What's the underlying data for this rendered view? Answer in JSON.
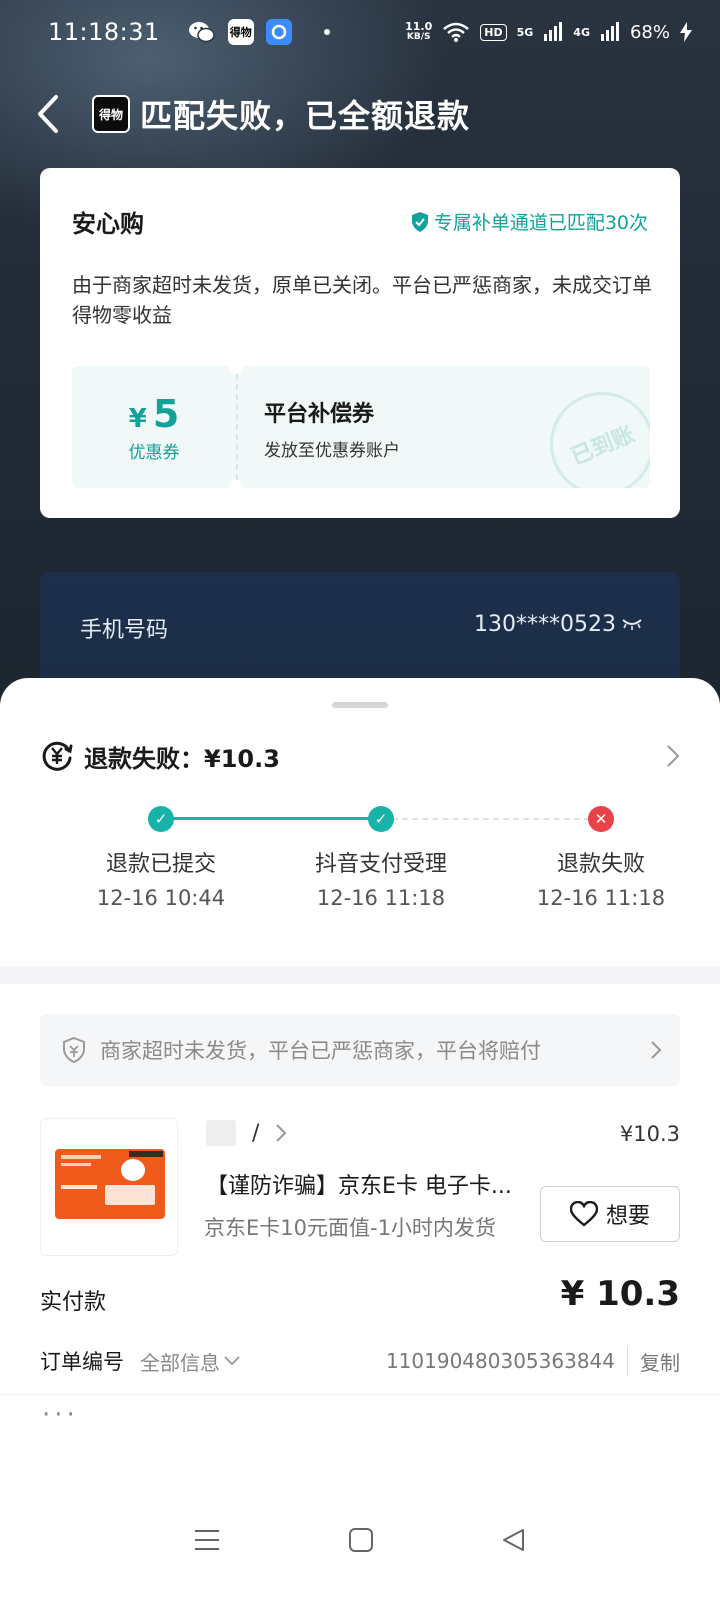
{
  "status_bar": {
    "time": "11:18:31",
    "net_speed": "11.0",
    "net_unit": "KB/S",
    "hd": "HD",
    "sig1": "5G",
    "sig2": "4G",
    "battery": "68%",
    "app_icon_dewu": "得物"
  },
  "header": {
    "title": "匹配失败，已全额退款",
    "logo_text": "得物"
  },
  "assurance_card": {
    "title": "安心购",
    "badge": "专属补单通道已匹配30次",
    "description": "由于商家超时未发货，原单已关闭。平台已严惩商家，未成交订单得物零收益",
    "coupon": {
      "currency": "¥",
      "amount": "5",
      "type_label": "优惠券",
      "title": "平台补偿券",
      "subtitle": "发放至优惠券账户",
      "stamp": "已到账"
    }
  },
  "phone_card": {
    "label": "手机号码",
    "value": "130****0523"
  },
  "refund": {
    "title": "退款失败：¥10.3",
    "steps": [
      {
        "label": "退款已提交",
        "time": "12-16 10:44",
        "status": "done"
      },
      {
        "label": "抖音支付受理",
        "time": "12-16 11:18",
        "status": "done"
      },
      {
        "label": "退款失败",
        "time": "12-16 11:18",
        "status": "failed"
      }
    ]
  },
  "notice": {
    "text": "商家超时未发货，平台已严惩商家，平台将赔付"
  },
  "product": {
    "shop_name": "/",
    "price": "¥10.3",
    "title": "【谨防诈骗】京东E卡 电子卡...",
    "spec": "京东E卡10元面值-1小时内发货",
    "want_label": "想要"
  },
  "payment": {
    "paid_label": "实付款",
    "paid_value": "¥ 10.3"
  },
  "order": {
    "label": "订单编号",
    "all_info": "全部信息",
    "number": "110190480305363844",
    "copy": "复制"
  },
  "more": "···",
  "colors": {
    "accent": "#17b3a8",
    "failed": "#e8424a",
    "dark_bg": "#222b36"
  }
}
